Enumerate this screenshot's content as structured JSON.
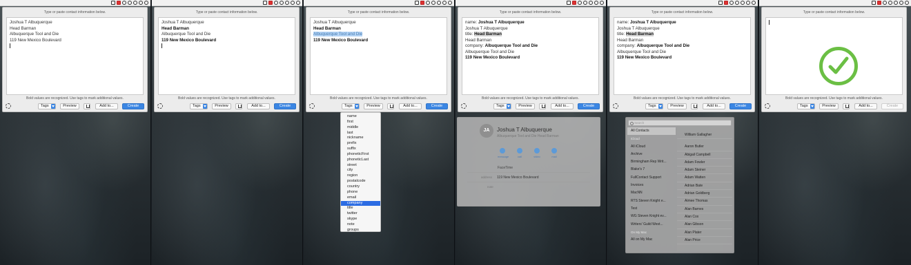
{
  "panel": {
    "hint": "Type or paste contact information below.",
    "footer": "Bold values are recognized. Use tags to mark additional values.",
    "tags": "Tags",
    "preview": "Preview",
    "addto": "Add to...",
    "create": "Create"
  },
  "f1": {
    "lines": [
      "Joshua T Albuquerque",
      "Head Barman",
      "Albuquerque Tool and Die",
      "119 New Mexico Boulevard"
    ]
  },
  "f2": {
    "lines": [
      "Joshua T Albuquerque",
      "Head Barman",
      "Albuquerque Tool and Die",
      "119 New Mexico Boulevard"
    ]
  },
  "f3": {
    "lines": [
      "Joshua T Albuquerque",
      "Head Barman",
      "Albuquerque Tool and Die",
      "119 New Mexico Boulevard"
    ],
    "tag_menu": [
      "name",
      "first",
      "middle",
      "last",
      "nickname",
      "prefix",
      "suffix",
      "phoneticFirst",
      "phoneticLast",
      "street",
      "city",
      "region",
      "postalcode",
      "country",
      "phone",
      "email",
      "company",
      "title",
      "twitter",
      "skype",
      "note",
      "groups"
    ],
    "selected_tag": "company"
  },
  "f4": {
    "l1": "name:",
    "l1v": "Joshua T Albuquerque",
    "l2": "Joshua T Albuquerque",
    "l3": "title:",
    "l3v": "Head Barman",
    "l4": "Head Barman",
    "l5": "company:",
    "l5v": "Albuquerque Tool and Die",
    "l6": "Albuquerque Tool and Die",
    "l7": "119 New Mexico Boulevard",
    "card": {
      "initials": "JA",
      "name": "Joshua T Albuquerque",
      "subtitle": "Albuquerque Tool and Die   Head Barman",
      "actions": [
        "message",
        "call",
        "video",
        "mail"
      ],
      "facetime": "FaceTime",
      "address_key": "address",
      "address_value": "119 New Mexico Boulevard",
      "notes": "note"
    }
  },
  "f5": {
    "search": "Search",
    "groups": [
      "All Contacts",
      "iCloud",
      "All iCloud",
      "Archive",
      "Birmingham Rep Writ...",
      "Blake's 7",
      "FullContact Support",
      "Invoices",
      "MacNN",
      "RTS Steven Knight e...",
      "Test",
      "WG Steven Knight ev...",
      "Writers' Guild West...",
      "On My Mac",
      "All on My Mac"
    ],
    "contacts": [
      "William Gallagher",
      "Aaron Butler",
      "Abigail Campbell",
      "Adam Fowler",
      "Adam Steiner",
      "Adam Watten",
      "Adrian Bate",
      "Adrian Goldberg",
      "Aimee Thomas",
      "Alan Barnes",
      "Alan Cox",
      "Alan Gibson",
      "Alan Plater",
      "Alan Price"
    ]
  }
}
